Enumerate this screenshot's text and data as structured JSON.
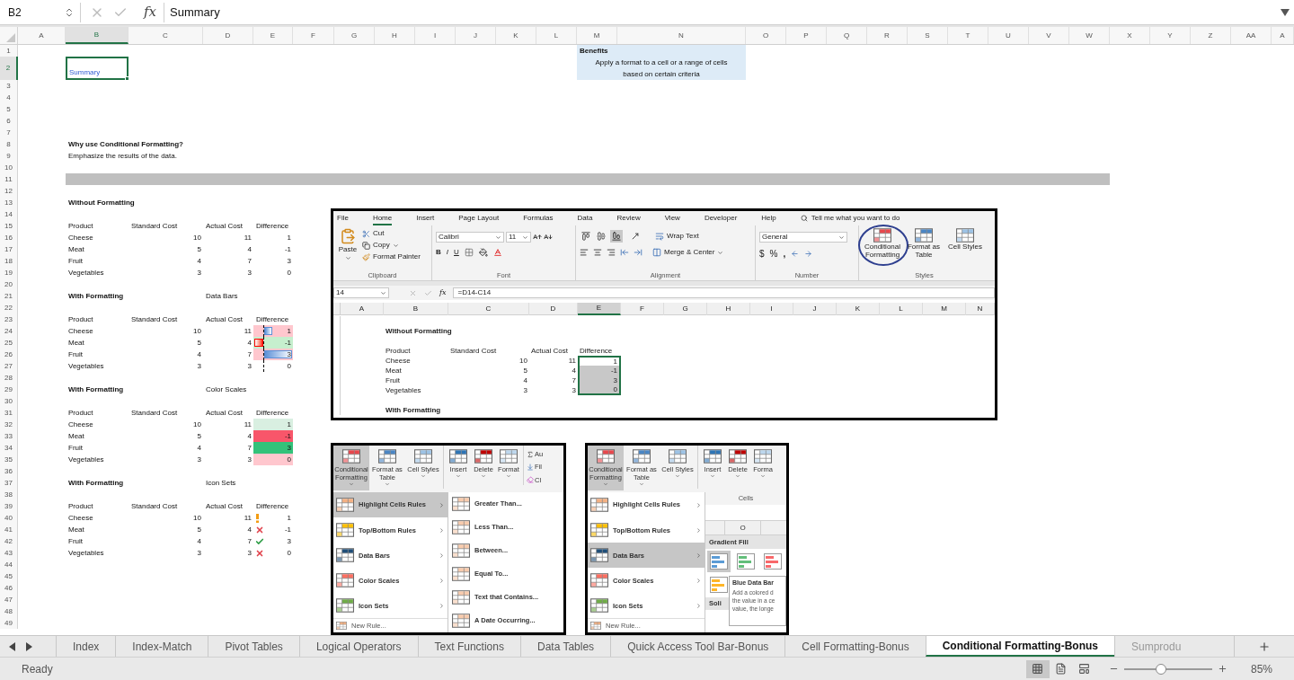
{
  "formula_bar": {
    "name_box": "B2",
    "fx": "fx",
    "formula": "Summary"
  },
  "columns": [
    {
      "label": "A",
      "selected": false
    },
    {
      "label": "B",
      "selected": true
    },
    {
      "label": "C",
      "selected": false
    },
    {
      "label": "D",
      "selected": false
    },
    {
      "label": "E",
      "selected": false
    },
    {
      "label": "F",
      "selected": false
    },
    {
      "label": "G",
      "selected": false
    },
    {
      "label": "H",
      "selected": false
    },
    {
      "label": "I",
      "selected": false
    },
    {
      "label": "J",
      "selected": false
    },
    {
      "label": "K",
      "selected": false
    },
    {
      "label": "L",
      "selected": false
    },
    {
      "label": "M",
      "selected": false
    },
    {
      "label": "N",
      "selected": false
    },
    {
      "label": "O",
      "selected": false
    },
    {
      "label": "P",
      "selected": false
    },
    {
      "label": "Q",
      "selected": false
    },
    {
      "label": "R",
      "selected": false
    },
    {
      "label": "S",
      "selected": false
    },
    {
      "label": "T",
      "selected": false
    },
    {
      "label": "U",
      "selected": false
    },
    {
      "label": "V",
      "selected": false
    },
    {
      "label": "W",
      "selected": false
    },
    {
      "label": "X",
      "selected": false
    },
    {
      "label": "Y",
      "selected": false
    },
    {
      "label": "Z",
      "selected": false
    },
    {
      "label": "AA",
      "selected": false
    },
    {
      "label": "A",
      "selected": false
    }
  ],
  "rows": [
    {
      "number": "1",
      "selected": false,
      "cells": {
        "M": {
          "text": "Benefits",
          "kind": "note-title"
        }
      }
    },
    {
      "number": "2",
      "selected": true,
      "cells": {
        "B": {
          "text": "Summary",
          "kind": "link",
          "selected": true
        },
        "M": {
          "text": "Apply a format to a cell or a range of cells based on certain criteria",
          "kind": "note"
        }
      }
    },
    {
      "number": "3",
      "selected": false
    },
    {
      "number": "4",
      "selected": false
    },
    {
      "number": "5",
      "selected": false
    },
    {
      "number": "6",
      "selected": false
    },
    {
      "number": "7",
      "selected": false
    },
    {
      "number": "8",
      "selected": false,
      "cells": {
        "B": {
          "text": "Why use Conditional Formatting?",
          "kind": "text",
          "bold": true
        }
      }
    },
    {
      "number": "9",
      "selected": false,
      "cells": {
        "B": {
          "text": "Emphasize the results of the data.",
          "kind": "text",
          "bold": false
        }
      }
    },
    {
      "number": "10",
      "selected": false
    },
    {
      "number": "11",
      "selected": false,
      "cells": {
        "B": {
          "kind": "band"
        }
      }
    },
    {
      "number": "12",
      "selected": false
    },
    {
      "number": "13",
      "selected": false,
      "cells": {
        "B": {
          "text": "Without Formatting",
          "kind": "text",
          "bold": true
        }
      }
    },
    {
      "number": "14",
      "selected": false
    },
    {
      "number": "15",
      "selected": false,
      "cells": {
        "B": {
          "text": "Product",
          "kind": "text",
          "bold": false
        },
        "C": {
          "text": "Standard Cost",
          "kind": "text",
          "bold": false
        },
        "D": {
          "text": "Actual Cost",
          "kind": "text",
          "bold": false
        },
        "E": {
          "text": "Difference",
          "kind": "text",
          "bold": false
        }
      }
    },
    {
      "number": "16",
      "selected": false,
      "cells": {
        "B": {
          "text": "Cheese",
          "kind": "text",
          "bold": false
        },
        "C": {
          "text": "10",
          "kind": "number"
        },
        "D": {
          "text": "11",
          "kind": "number"
        },
        "E": {
          "text": "1",
          "kind": "number"
        }
      }
    },
    {
      "number": "17",
      "selected": false,
      "cells": {
        "B": {
          "text": "Meat",
          "kind": "text",
          "bold": false
        },
        "C": {
          "text": "5",
          "kind": "number"
        },
        "D": {
          "text": "4",
          "kind": "number"
        },
        "E": {
          "text": "-1",
          "kind": "number"
        }
      }
    },
    {
      "number": "18",
      "selected": false,
      "cells": {
        "B": {
          "text": "Fruit",
          "kind": "text",
          "bold": false
        },
        "C": {
          "text": "4",
          "kind": "number"
        },
        "D": {
          "text": "7",
          "kind": "number"
        },
        "E": {
          "text": "3",
          "kind": "number"
        }
      }
    },
    {
      "number": "19",
      "selected": false,
      "cells": {
        "B": {
          "text": "Vegetables",
          "kind": "text",
          "bold": false
        },
        "C": {
          "text": "3",
          "kind": "number"
        },
        "D": {
          "text": "3",
          "kind": "number"
        },
        "E": {
          "text": "0",
          "kind": "number"
        }
      }
    },
    {
      "number": "20",
      "selected": false
    },
    {
      "number": "21",
      "selected": false,
      "cells": {
        "B": {
          "text": "With Formatting",
          "kind": "text",
          "bold": true
        },
        "D": {
          "text": "Data Bars",
          "kind": "text",
          "bold": false
        }
      }
    },
    {
      "number": "22",
      "selected": false
    },
    {
      "number": "23",
      "selected": false,
      "cells": {
        "B": {
          "text": "Product",
          "kind": "text",
          "bold": false
        },
        "C": {
          "text": "Standard Cost",
          "kind": "text",
          "bold": false
        },
        "D": {
          "text": "Actual Cost",
          "kind": "text",
          "bold": false
        },
        "E": {
          "text": "Difference",
          "kind": "text",
          "bold": false
        }
      }
    },
    {
      "number": "24",
      "selected": false,
      "cells": {
        "B": {
          "text": "Cheese",
          "kind": "text",
          "bold": false
        },
        "C": {
          "text": "10",
          "kind": "number"
        },
        "D": {
          "text": "11",
          "kind": "number"
        },
        "E": {
          "text": "1",
          "kind": "data-bar",
          "level": 0.3,
          "color": "#ffc7ce"
        }
      }
    },
    {
      "number": "25",
      "selected": false,
      "cells": {
        "B": {
          "text": "Meat",
          "kind": "text",
          "bold": false
        },
        "C": {
          "text": "5",
          "kind": "number"
        },
        "D": {
          "text": "4",
          "kind": "number"
        },
        "E": {
          "text": "-1",
          "kind": "negative-bar",
          "color": "#c6efce"
        }
      }
    },
    {
      "number": "26",
      "selected": false,
      "cells": {
        "B": {
          "text": "Fruit",
          "kind": "text",
          "bold": false
        },
        "C": {
          "text": "4",
          "kind": "number"
        },
        "D": {
          "text": "7",
          "kind": "number"
        },
        "E": {
          "text": "3",
          "kind": "data-bar-full",
          "color": "#ffc7ce"
        }
      }
    },
    {
      "number": "27",
      "selected": false,
      "cells": {
        "B": {
          "text": "Vegetables",
          "kind": "text",
          "bold": false
        },
        "C": {
          "text": "3",
          "kind": "number"
        },
        "D": {
          "text": "3",
          "kind": "number"
        },
        "E": {
          "text": "0",
          "kind": "data-bar"
        }
      }
    },
    {
      "number": "28",
      "selected": false
    },
    {
      "number": "29",
      "selected": false,
      "cells": {
        "B": {
          "text": "With Formatting",
          "kind": "text",
          "bold": true
        },
        "D": {
          "text": "Color Scales",
          "kind": "text",
          "bold": false
        }
      }
    },
    {
      "number": "30",
      "selected": false
    },
    {
      "number": "31",
      "selected": false,
      "cells": {
        "B": {
          "text": "Product",
          "kind": "text",
          "bold": false
        },
        "C": {
          "text": "Standard Cost",
          "kind": "text",
          "bold": false
        },
        "D": {
          "text": "Actual Cost",
          "kind": "text",
          "bold": false
        },
        "E": {
          "text": "Difference",
          "kind": "text",
          "bold": false
        }
      }
    },
    {
      "number": "32",
      "selected": false,
      "cells": {
        "B": {
          "text": "Cheese",
          "kind": "text",
          "bold": false
        },
        "C": {
          "text": "10",
          "kind": "number"
        },
        "D": {
          "text": "11",
          "kind": "number"
        },
        "E": {
          "text": "1",
          "kind": "number",
          "color": "#d9efe1"
        }
      }
    },
    {
      "number": "33",
      "selected": false,
      "cells": {
        "B": {
          "text": "Meat",
          "kind": "text",
          "bold": false
        },
        "C": {
          "text": "5",
          "kind": "number"
        },
        "D": {
          "text": "4",
          "kind": "number"
        },
        "E": {
          "text": "-1",
          "kind": "number",
          "color": "#f8566a"
        }
      }
    },
    {
      "number": "34",
      "selected": false,
      "cells": {
        "B": {
          "text": "Fruit",
          "kind": "text",
          "bold": false
        },
        "C": {
          "text": "4",
          "kind": "number"
        },
        "D": {
          "text": "7",
          "kind": "number"
        },
        "E": {
          "text": "3",
          "kind": "number",
          "color": "#33c27a"
        }
      }
    },
    {
      "number": "35",
      "selected": false,
      "cells": {
        "B": {
          "text": "Vegetables",
          "kind": "text",
          "bold": false
        },
        "C": {
          "text": "3",
          "kind": "number"
        },
        "D": {
          "text": "3",
          "kind": "number"
        },
        "E": {
          "text": "0",
          "kind": "number",
          "color": "#ffc7ce"
        }
      }
    },
    {
      "number": "36",
      "selected": false
    },
    {
      "number": "37",
      "selected": false,
      "cells": {
        "B": {
          "text": "With Formatting",
          "kind": "text",
          "bold": true
        },
        "D": {
          "text": "Icon Sets",
          "kind": "text",
          "bold": false
        }
      }
    },
    {
      "number": "38",
      "selected": false
    },
    {
      "number": "39",
      "selected": false,
      "cells": {
        "B": {
          "text": "Product",
          "kind": "text",
          "bold": false
        },
        "C": {
          "text": "Standard Cost",
          "kind": "text",
          "bold": false
        },
        "D": {
          "text": "Actual Cost",
          "kind": "text",
          "bold": false
        },
        "E": {
          "text": "Difference",
          "kind": "text",
          "bold": false
        }
      }
    },
    {
      "number": "40",
      "selected": false,
      "cells": {
        "B": {
          "text": "Cheese",
          "kind": "text",
          "bold": false
        },
        "C": {
          "text": "10",
          "kind": "number"
        },
        "D": {
          "text": "11",
          "kind": "number"
        },
        "E": {
          "text": "1",
          "kind": "icon-warning"
        }
      }
    },
    {
      "number": "41",
      "selected": false,
      "cells": {
        "B": {
          "text": "Meat",
          "kind": "text",
          "bold": false
        },
        "C": {
          "text": "5",
          "kind": "number"
        },
        "D": {
          "text": "4",
          "kind": "number"
        },
        "E": {
          "text": "-1",
          "kind": "icon-bad"
        }
      }
    },
    {
      "number": "42",
      "selected": false,
      "cells": {
        "B": {
          "text": "Fruit",
          "kind": "text",
          "bold": false
        },
        "C": {
          "text": "4",
          "kind": "number"
        },
        "D": {
          "text": "7",
          "kind": "number"
        },
        "E": {
          "text": "3",
          "kind": "icon-good"
        }
      }
    },
    {
      "number": "43",
      "selected": false,
      "cells": {
        "B": {
          "text": "Vegetables",
          "kind": "text",
          "bold": false
        },
        "C": {
          "text": "3",
          "kind": "number"
        },
        "D": {
          "text": "3",
          "kind": "number"
        },
        "E": {
          "text": "0",
          "kind": "icon-bad"
        }
      }
    },
    {
      "number": "44",
      "selected": false
    },
    {
      "number": "45",
      "selected": false
    },
    {
      "number": "46",
      "selected": false
    },
    {
      "number": "47",
      "selected": false
    },
    {
      "number": "48",
      "selected": false
    },
    {
      "number": "49",
      "selected": false
    }
  ],
  "tutorial_screenshots": [
    {
      "kind": "ribbon-sheet",
      "ribbon_tabs": [
        {
          "label": "File",
          "selected": false
        },
        {
          "label": "Home",
          "selected": true
        },
        {
          "label": "Insert",
          "selected": false
        },
        {
          "label": "Page Layout",
          "selected": false
        },
        {
          "label": "Formulas",
          "selected": false
        },
        {
          "label": "Data",
          "selected": false
        },
        {
          "label": "Review",
          "selected": false
        },
        {
          "label": "View",
          "selected": false
        },
        {
          "label": "Developer",
          "selected": false
        },
        {
          "label": "Help",
          "selected": false
        }
      ],
      "search_hint": "Tell me what you want to do",
      "clipboard": {
        "paste": "Paste",
        "cut": "Cut",
        "copy": "Copy",
        "format_painter": "Format Painter",
        "label": "Clipboard"
      },
      "font": {
        "name": "Calibri",
        "size": "11",
        "bold": "B",
        "italic": "I",
        "underline": "U",
        "label": "Font"
      },
      "alignment": {
        "vertical": [
          {
            "selected": false
          },
          {
            "selected": false
          },
          {
            "selected": true
          }
        ],
        "wrap": "Wrap Text",
        "merge": "Merge & Center",
        "label": "Alignment"
      },
      "number": {
        "format": "General",
        "currency": "$",
        "percent": "%",
        "comma": ",",
        "label": "Number"
      },
      "styles": {
        "buttons": [
          {
            "label": "Conditional Formatting",
            "kind": "conditional",
            "circled": true
          },
          {
            "label": "Format as Table",
            "kind": "table",
            "circled": false
          },
          {
            "label": "Cell Styles",
            "kind": "styles",
            "circled": false
          }
        ],
        "label": "Styles"
      },
      "name_box": "14",
      "fx": "fx",
      "formula": "=D14-C14",
      "columns": [
        {
          "label": "A",
          "selected": false
        },
        {
          "label": "B",
          "selected": false
        },
        {
          "label": "C",
          "selected": false
        },
        {
          "label": "D",
          "selected": false
        },
        {
          "label": "E",
          "selected": true
        },
        {
          "label": "F",
          "selected": false
        },
        {
          "label": "G",
          "selected": false
        },
        {
          "label": "H",
          "selected": false
        },
        {
          "label": "I",
          "selected": false
        },
        {
          "label": "J",
          "selected": false
        },
        {
          "label": "K",
          "selected": false
        },
        {
          "label": "L",
          "selected": false
        },
        {
          "label": "M",
          "selected": false
        },
        {
          "label": "N",
          "selected": false
        }
      ],
      "rows": [
        {
          "kind": "blank"
        },
        {
          "kind": "data",
          "cells": {
            "B": {
              "text": "Without Formatting",
              "kind": "text",
              "bold": true
            }
          }
        },
        {
          "kind": "blank"
        },
        {
          "kind": "data",
          "cells": {
            "B": {
              "text": "Product",
              "kind": "text",
              "bold": false
            },
            "C": {
              "text": "Standard Cost",
              "kind": "text",
              "bold": false
            },
            "D": {
              "text": "Actual Cost",
              "kind": "text",
              "bold": false
            },
            "E": {
              "text": "Difference",
              "kind": "text",
              "bold": false
            }
          }
        },
        {
          "kind": "data",
          "cells": {
            "B": {
              "text": "Cheese",
              "kind": "text",
              "bold": false
            },
            "C": {
              "text": "10",
              "kind": "number"
            },
            "D": {
              "text": "11",
              "kind": "number"
            },
            "E": {
              "text": "1",
              "kind": "number",
              "selected": true,
              "active": true
            }
          }
        },
        {
          "kind": "data",
          "cells": {
            "B": {
              "text": "Meat",
              "kind": "text",
              "bold": false
            },
            "C": {
              "text": "5",
              "kind": "number"
            },
            "D": {
              "text": "4",
              "kind": "number"
            },
            "E": {
              "text": "-1",
              "kind": "number",
              "selected": true,
              "active": false
            }
          }
        },
        {
          "kind": "data",
          "cells": {
            "B": {
              "text": "Fruit",
              "kind": "text",
              "bold": false
            },
            "C": {
              "text": "4",
              "kind": "number"
            },
            "D": {
              "text": "7",
              "kind": "number"
            },
            "E": {
              "text": "3",
              "kind": "number",
              "selected": true,
              "active": false
            }
          }
        },
        {
          "kind": "data",
          "cells": {
            "B": {
              "text": "Vegetables",
              "kind": "text",
              "bold": false
            },
            "C": {
              "text": "3",
              "kind": "number"
            },
            "D": {
              "text": "3",
              "kind": "number"
            },
            "E": {
              "text": "0",
              "kind": "number",
              "selected": true,
              "active": false
            }
          }
        },
        {
          "kind": "blank"
        },
        {
          "kind": "data",
          "cells": {
            "B": {
              "text": "With Formatting",
              "kind": "text",
              "bold": true
            }
          }
        }
      ]
    },
    {
      "kind": "menu",
      "ribbon_buttons": [
        {
          "label": "Conditional Formatting",
          "kind": "conditional",
          "selected": true
        },
        {
          "label": "Format as Table",
          "kind": "table",
          "selected": false
        },
        {
          "label": "Cell Styles",
          "kind": "styles",
          "selected": false
        },
        {
          "label": "Insert",
          "kind": "insert",
          "selected": false
        },
        {
          "label": "Delete",
          "kind": "delete",
          "selected": false
        },
        {
          "label": "Format",
          "kind": "format",
          "selected": false
        }
      ],
      "editing": [
        {
          "label": "Au",
          "kind": "sum"
        },
        {
          "label": "Fil",
          "kind": "fill"
        },
        {
          "label": "Cl",
          "kind": "clear"
        }
      ],
      "menu": [
        {
          "label": "Highlight Cells Rules",
          "kind": "highlight",
          "selected": true
        },
        {
          "label": "Top/Bottom Rules",
          "kind": "topbottom",
          "selected": false
        },
        {
          "label": "Data Bars",
          "kind": "databars",
          "selected": false
        },
        {
          "label": "Color Scales",
          "kind": "colorscales",
          "selected": false
        },
        {
          "label": "Icon Sets",
          "kind": "iconsets",
          "selected": false
        }
      ],
      "new_rule": "New Rule...",
      "submenu": {
        "kind": "rules",
        "items": [
          {
            "label": "Greater Than..."
          },
          {
            "label": "Less Than..."
          },
          {
            "label": "Between..."
          },
          {
            "label": "Equal To..."
          },
          {
            "label": "Text that Contains..."
          },
          {
            "label": "A Date Occurring..."
          }
        ]
      }
    },
    {
      "kind": "menu",
      "ribbon_buttons": [
        {
          "label": "Conditional Formatting",
          "kind": "conditional",
          "selected": true
        },
        {
          "label": "Format as Table",
          "kind": "table",
          "selected": false
        },
        {
          "label": "Cell Styles",
          "kind": "styles",
          "selected": false
        },
        {
          "label": "Insert",
          "kind": "insert",
          "selected": false
        },
        {
          "label": "Delete",
          "kind": "delete",
          "selected": false
        },
        {
          "label": "Forma",
          "kind": "format",
          "selected": false
        }
      ],
      "group_label": "Cells",
      "column_header": "O",
      "menu": [
        {
          "label": "Highlight Cells Rules",
          "kind": "highlight",
          "selected": false
        },
        {
          "label": "Top/Bottom Rules",
          "kind": "topbottom",
          "selected": false
        },
        {
          "label": "Data Bars",
          "kind": "databars",
          "selected": true
        },
        {
          "label": "Color Scales",
          "kind": "colorscales",
          "selected": false
        },
        {
          "label": "Icon Sets",
          "kind": "iconsets",
          "selected": false
        }
      ],
      "new_rule": "New Rule...",
      "submenu": {
        "kind": "data-bars",
        "heading": "Gradient Fill",
        "swatches": [
          {
            "color": "#5b9bd5",
            "selected": true
          },
          {
            "color": "#63be7b",
            "selected": false
          },
          {
            "color": "#f8696b",
            "selected": false
          },
          {
            "color": "#ffb628",
            "selected": false
          }
        ],
        "subheading": "Soli",
        "tooltip": {
          "title": "Blue Data Bar",
          "lines": [
            "Add a colored d",
            "the value in a ce",
            "value, the longe"
          ]
        }
      }
    }
  ],
  "sheet_tabs": [
    {
      "label": "Index",
      "selected": false
    },
    {
      "label": "Index-Match",
      "selected": false
    },
    {
      "label": "Pivot Tables",
      "selected": false
    },
    {
      "label": "Logical Operators",
      "selected": false
    },
    {
      "label": "Text Functions",
      "selected": false
    },
    {
      "label": "Data Tables",
      "selected": false
    },
    {
      "label": "Quick Access Tool Bar-Bonus",
      "selected": false
    },
    {
      "label": "Cell Formatting-Bonus",
      "selected": false
    },
    {
      "label": "Conditional Formatting-Bonus",
      "selected": true
    },
    {
      "label": "Sumprodu",
      "selected": false
    }
  ],
  "status_bar": {
    "status": "Ready",
    "views": [
      {
        "kind": "normal",
        "selected": true
      },
      {
        "kind": "page-layout",
        "selected": false
      },
      {
        "kind": "page-break",
        "selected": false
      }
    ],
    "zoom": {
      "level": 0.42,
      "reading": "85%"
    }
  }
}
